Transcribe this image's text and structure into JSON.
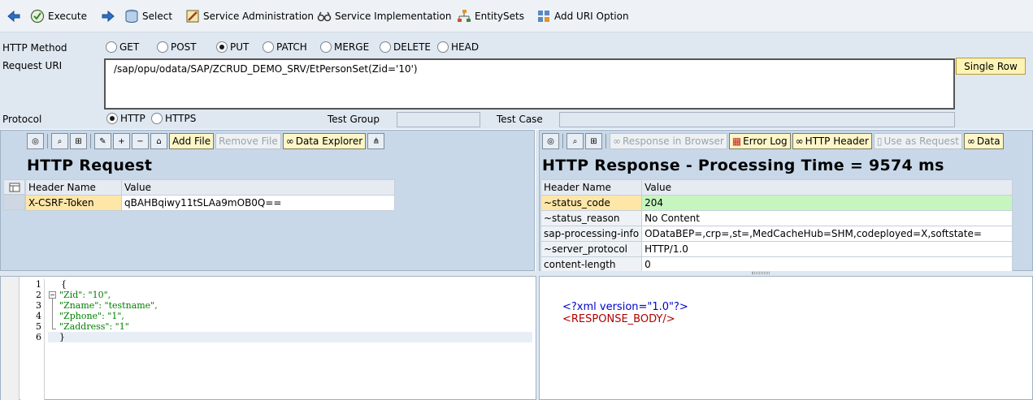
{
  "toolbar": {
    "execute": "Execute",
    "select": "Select",
    "service_admin": "Service Administration",
    "service_impl": "Service Implementation",
    "entitysets": "EntitySets",
    "add_uri_option": "Add URI Option"
  },
  "form": {
    "http_method_label": "HTTP Method",
    "methods": [
      "GET",
      "POST",
      "PUT",
      "PATCH",
      "MERGE",
      "DELETE",
      "HEAD"
    ],
    "selected_method": "PUT",
    "request_uri_label": "Request URI",
    "request_uri": "/sap/opu/odata/SAP/ZCRUD_DEMO_SRV/EtPersonSet(Zid='10')",
    "single_row": "Single Row",
    "protocol_label": "Protocol",
    "protocols": [
      "HTTP",
      "HTTPS"
    ],
    "selected_protocol": "HTTP",
    "test_group_label": "Test Group",
    "test_case_label": "Test Case"
  },
  "request_panel": {
    "buttons": {
      "add_file": "Add File",
      "remove_file": "Remove File",
      "data_explorer": "Data Explorer"
    },
    "title": "HTTP Request",
    "headers": {
      "col_name": "Header Name",
      "col_value": "Value"
    },
    "rows": [
      {
        "name": "X-CSRF-Token",
        "value": "qBAHBqiwy11tSLAa9mOB0Q=="
      }
    ]
  },
  "response_panel": {
    "buttons": {
      "response_in_browser": "Response in Browser",
      "error_log": "Error Log",
      "http_header": "HTTP Header",
      "use_as_request": "Use as Request",
      "data": "Data"
    },
    "title": "HTTP Response - Processing Time = 9574  ms",
    "headers": {
      "col_name": "Header Name",
      "col_value": "Value"
    },
    "rows": [
      {
        "name": "~status_code",
        "value": "204"
      },
      {
        "name": "~status_reason",
        "value": "No Content"
      },
      {
        "name": "sap-processing-info",
        "value": "ODataBEP=,crp=,st=,MedCacheHub=SHM,codeployed=X,softstate="
      },
      {
        "name": "~server_protocol",
        "value": "HTTP/1.0"
      },
      {
        "name": "content-length",
        "value": "0"
      }
    ]
  },
  "request_body": {
    "line_numbers": [
      "1",
      "2",
      "3",
      "4",
      "5",
      "6"
    ],
    "lines": [
      "{",
      "\"Zid\": \"10\",",
      "\"Zname\": \"testname\",",
      "\"Zphone\": \"1\",",
      "\"Zaddress\": \"1\"",
      "}"
    ]
  },
  "response_body": {
    "xml_decl": "<?xml version=\"1.0\"?>",
    "root": "<RESPONSE_BODY/>"
  },
  "colors": {
    "toolbar_bg": "#eef2f6",
    "form_bg": "#dfe8f1",
    "panel_bg": "#c8d8e8",
    "status_highlight": "#c6f5c0",
    "selected_cell": "#fde6a8"
  }
}
